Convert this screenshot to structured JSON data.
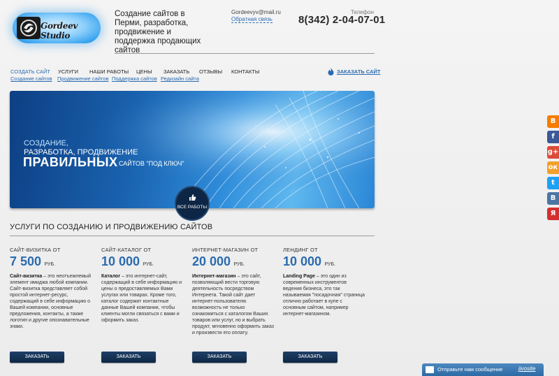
{
  "header": {
    "logo_text": "Gordeev Studio",
    "tagline": "Создание сайтов в Перми, разработка, продвижение и поддержка продающих сайтов",
    "email": "Gordeevyv@mail.ru",
    "feedback_link": "Обратная связь",
    "phone_label": "Телефон",
    "phone": "8(342) 2-04-07-01"
  },
  "nav": {
    "items": [
      {
        "label": "СОЗДАТЬ САЙТ",
        "active": true
      },
      {
        "label": "УСЛУГИ"
      },
      {
        "label": "НАШИ РАБОТЫ"
      },
      {
        "label": "ЦЕНЫ"
      },
      {
        "label": "ЗАКАЗАТЬ"
      },
      {
        "label": "ОТЗЫВЫ"
      },
      {
        "label": "КОНТАКТЫ"
      }
    ],
    "sub_links": [
      {
        "label": "Создание сайтов"
      },
      {
        "label": "Продвижение сайтов"
      },
      {
        "label": "Поддержка сайтов"
      },
      {
        "label": "Редизайн сайта"
      }
    ],
    "cta": "ЗАКАЗАТЬ САЙТ"
  },
  "banner": {
    "line1": "СОЗДАНИЕ,",
    "line2": "РАЗРАБОТКА, ПРОДВИЖЕНИЕ",
    "big": "ПРАВИЛЬНЫХ",
    "small": "САЙТОВ \"ПОД КЛЮЧ\"",
    "works_button": "ВСЕ РАБОТЫ"
  },
  "services_section": {
    "title": "УСЛУГИ ПО СОЗДАНИЮ И ПРОДВИЖЕНИЮ САЙТОВ",
    "items": [
      {
        "title": "САЙТ-ВИЗИТКА ОТ",
        "price": "7 500",
        "currency": "РУБ.",
        "desc_bold": "Сайт-визитка",
        "desc": " – это неотъемлемый элемент имиджа любой компании. Сайт-визитка представляет собой простой интернет-ресурс, содержащий в себе информацию о Вашей компании, основные предложения, контакты, а также логотип и другие опознавательные знаки.",
        "button": "ЗАКАЗАТЬ"
      },
      {
        "title": "САЙТ-КАТАЛОГ ОТ",
        "price": "10 000",
        "currency": "РУБ.",
        "desc_bold": "Каталог",
        "desc": " – это интернет-сайт, содержащий в себе информацию и цены о предоставляемых Вами услугах или товарах. Кроме того, каталог содержит контактные данные Вашей компании, чтобы клиенты могли связаться с вами и оформить заказ.",
        "button": "ЗАКАЗАТЬ"
      },
      {
        "title": "ИНТЕРНЕТ-МАГАЗИН ОТ",
        "price": "20 000",
        "currency": "РУБ.",
        "desc_bold": "Интернет-магазин",
        "desc": " – это сайт, позволяющий вести торговую деятельность посредством Интернета. Такой сайт дает интернет-пользователю возможность не только ознакомиться с каталогом Ваших товаров или услуг, но и выбрать продукт, мгновенно оформить заказ и произвести его оплату.",
        "button": "ЗАКАЗАТЬ"
      },
      {
        "title": "ЛЕНДИНГ ОТ",
        "price": "10 000",
        "currency": "РУБ.",
        "desc_bold": "Landing Page",
        "desc": " – это один из современных инструментов ведения бизнеса, это так называемая \"посадочная\" страница отлично работает в купе с основным сайтом, например интернет-магазином.",
        "button": "ЗАКАЗАТЬ"
      }
    ]
  },
  "social": [
    {
      "icon": "blogger-icon",
      "glyph": "B",
      "color": "#f57d00"
    },
    {
      "icon": "facebook-icon",
      "glyph": "f",
      "color": "#3b5998"
    },
    {
      "icon": "google-plus-icon",
      "glyph": "g+",
      "color": "#dd4b39"
    },
    {
      "icon": "odnoklassniki-icon",
      "glyph": "ок",
      "color": "#f2a029"
    },
    {
      "icon": "twitter-icon",
      "glyph": "t",
      "color": "#1da1f2"
    },
    {
      "icon": "vkontakte-icon",
      "glyph": "В",
      "color": "#4c75a3"
    },
    {
      "icon": "liveinternet-icon",
      "glyph": "Я",
      "color": "#d42e2e"
    }
  ],
  "chat": {
    "label": "Отправьте нам сообщение",
    "brand": "jivosite"
  }
}
